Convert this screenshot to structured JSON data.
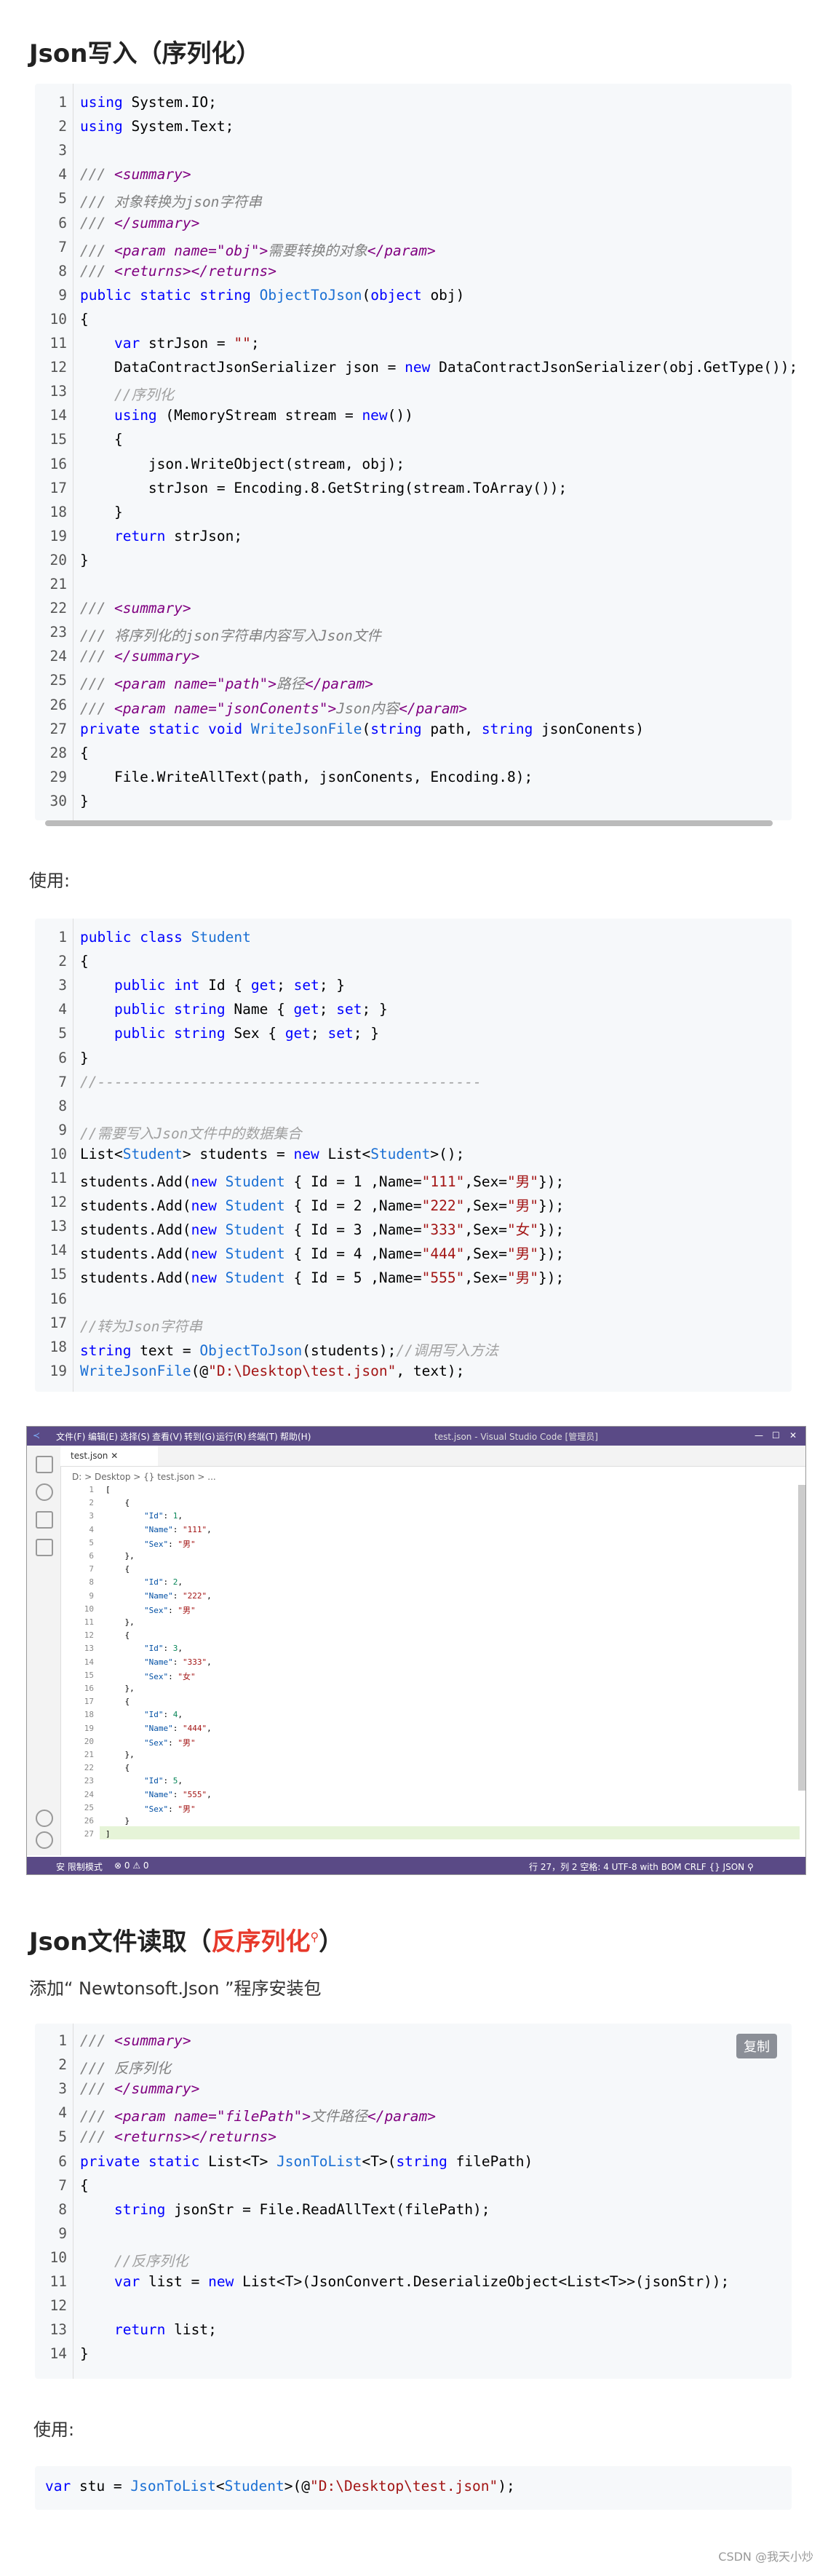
{
  "section1": {
    "title": "Json写入（序列化）"
  },
  "code1": {
    "lines": [
      "using System.IO;",
      "using System.Text;",
      "",
      "/// <summary>",
      "/// 对象转换为json字符串",
      "/// </summary>",
      "/// <param name=\"obj\">需要转换的对象</param>",
      "/// <returns></returns>",
      "public static string ObjectToJson(object obj)",
      "{",
      "    var strJson = \"\";",
      "    DataContractJsonSerializer json = new DataContractJsonSerializer(obj.GetType());",
      "    //序列化",
      "    using (MemoryStream stream = new())",
      "    {",
      "        json.WriteObject(stream, obj);",
      "        strJson = Encoding.UTF8.GetString(stream.ToArray());",
      "    }",
      "    return strJson;",
      "}",
      "",
      "/// <summary>",
      "/// 将序列化的json字符串内容写入Json文件",
      "/// </summary>",
      "/// <param name=\"path\">路径</param>",
      "/// <param name=\"jsonConents\">Json内容</param>",
      "private static void WriteJsonFile(string path, string jsonConents)",
      "{",
      "    File.WriteAllText(path, jsonConents, Encoding.UTF8);",
      "}"
    ]
  },
  "use1": {
    "label": "使用:"
  },
  "code2": {
    "lines": [
      "public class Student",
      "{",
      "    public int Id { get; set; }",
      "    public string Name { get; set; }",
      "    public string Sex { get; set; }",
      "}",
      "//---------------------------------------------",
      "",
      "//需要写入Json文件中的数据集合",
      "List<Student> students = new List<Student>();",
      "students.Add(new Student { Id = 1 ,Name=\"111\",Sex=\"男\"});",
      "students.Add(new Student { Id = 2 ,Name=\"222\",Sex=\"男\"});",
      "students.Add(new Student { Id = 3 ,Name=\"333\",Sex=\"女\"});",
      "students.Add(new Student { Id = 4 ,Name=\"444\",Sex=\"男\"});",
      "students.Add(new Student { Id = 5 ,Name=\"555\",Sex=\"男\"});",
      "",
      "//转为Json字符串",
      "string text = ObjectToJson(students);//调用写入方法",
      "WriteJsonFile(@\"D:\\Desktop\\test.json\", text);"
    ]
  },
  "vscode": {
    "menu": [
      "文件(F)",
      "编辑(E)",
      "选择(S)",
      "查看(V)",
      "转到(G)",
      "运行(R)",
      "终端(T)",
      "帮助(H)"
    ],
    "window_title": "test.json - Visual Studio Code [管理员]",
    "tab": "test.json",
    "breadcrumb": "D: > Desktop > {} test.json > ...",
    "lines": [
      "[",
      "    {",
      "        \"Id\": 1,",
      "        \"Name\": \"111\",",
      "        \"Sex\": \"男\"",
      "    },",
      "    {",
      "        \"Id\": 2,",
      "        \"Name\": \"222\",",
      "        \"Sex\": \"男\"",
      "    },",
      "    {",
      "        \"Id\": 3,",
      "        \"Name\": \"333\",",
      "        \"Sex\": \"女\"",
      "    },",
      "    {",
      "        \"Id\": 4,",
      "        \"Name\": \"444\",",
      "        \"Sex\": \"男\"",
      "    },",
      "    {",
      "        \"Id\": 5,",
      "        \"Name\": \"555\",",
      "        \"Sex\": \"男\"",
      "    }",
      "]"
    ],
    "status_left": "安 限制模式",
    "status_problems": "⊗ 0 ⚠ 0",
    "status_right": "行 27，列 2   空格: 4   UTF-8 with BOM   CRLF   {} JSON   ⚲"
  },
  "section2": {
    "title_a": "Json文件读取（",
    "title_b": "反序列化",
    "title_c": "）"
  },
  "section2_desc": "添加“ Newtonsoft.Json ”程序安装包",
  "copy_label": "复制",
  "code3": {
    "lines": [
      "/// <summary>",
      "/// 反序列化",
      "/// </summary>",
      "/// <param name=\"filePath\">文件路径</param>",
      "/// <returns></returns>",
      "private static List<T> JsonToList<T>(string filePath)",
      "{",
      "    string jsonStr = File.ReadAllText(filePath);",
      "",
      "    //反序列化",
      "    var list = new List<T>(JsonConvert.DeserializeObject<List<T>>(jsonStr));",
      "",
      "    return list;",
      "}"
    ]
  },
  "use2": {
    "label": "使用:"
  },
  "code4": {
    "line": "var stu = JsonToList<Student>(@\"D:\\Desktop\\test.json\");"
  },
  "watermark": "CSDN @我天小炒"
}
